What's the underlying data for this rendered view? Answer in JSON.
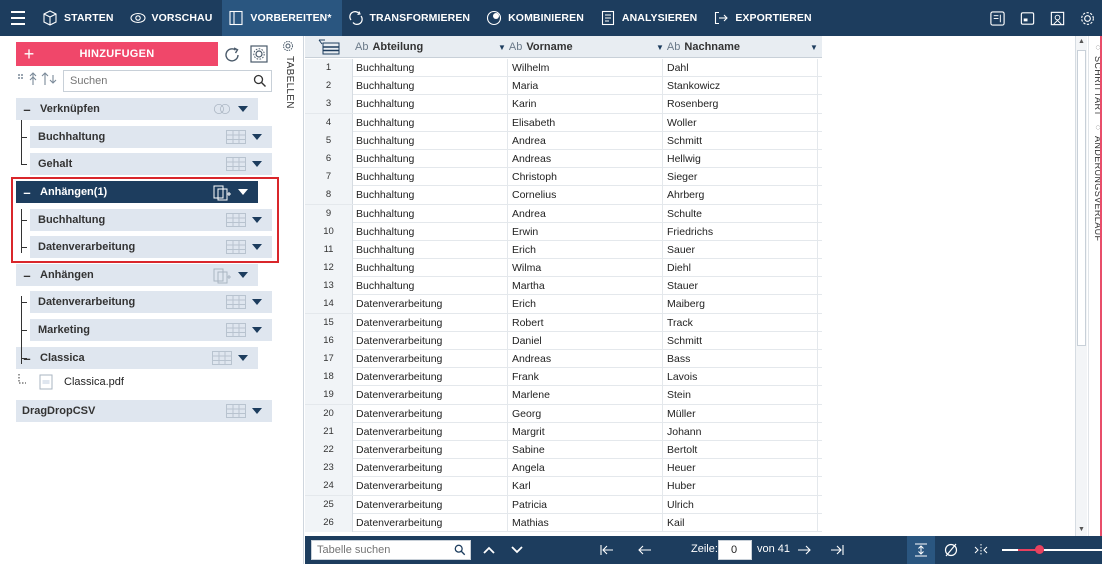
{
  "topbar": {
    "tabs": [
      {
        "label": "STARTEN",
        "icon": "cube-icon"
      },
      {
        "label": "VORSCHAU",
        "icon": "eye-icon"
      },
      {
        "label": "VORBEREITEN*",
        "icon": "table-columns-icon",
        "active": true
      },
      {
        "label": "TRANSFORMIEREN",
        "icon": "transform-icon"
      },
      {
        "label": "KOMBINIEREN",
        "icon": "combine-icon"
      },
      {
        "label": "ANALYSIEREN",
        "icon": "analyze-icon"
      },
      {
        "label": "EXPORTIEREN",
        "icon": "export-icon"
      }
    ],
    "right_icons": [
      "panel-icon",
      "window-icon",
      "book-icon",
      "gear-icon"
    ]
  },
  "colors": {
    "topbar": "#1d3d5e",
    "active_tab": "#2a5680",
    "add_button": "#f0476a",
    "highlight": "#d9262b",
    "group_bg": "#dfe6ef"
  },
  "left": {
    "add_label": "HINZUFUGEN",
    "tabellen_label": "TABELLEN",
    "search_placeholder": "Suchen",
    "tree": [
      {
        "kind": "group",
        "label": "Verknüpfen",
        "icon": "join-icon"
      },
      {
        "kind": "child",
        "label": "Buchhaltung"
      },
      {
        "kind": "child",
        "label": "Gehalt"
      },
      {
        "kind": "group-dark",
        "label": "Anhängen(1)",
        "icon": "append-icon"
      },
      {
        "kind": "child",
        "label": "Buchhaltung"
      },
      {
        "kind": "child",
        "label": "Datenverarbeitung"
      },
      {
        "kind": "group",
        "label": "Anhängen",
        "icon": "append-icon"
      },
      {
        "kind": "child",
        "label": "Datenverarbeitung"
      },
      {
        "kind": "child",
        "label": "Marketing"
      },
      {
        "kind": "group",
        "label": "Classica",
        "icon": "table-icon"
      },
      {
        "kind": "file",
        "label": "Classica.pdf"
      },
      {
        "kind": "table",
        "label": "DragDropCSV"
      }
    ]
  },
  "table": {
    "headers": [
      {
        "type": "Ab",
        "label": "Abteilung"
      },
      {
        "type": "Ab",
        "label": "Vorname"
      },
      {
        "type": "Ab",
        "label": "Nachname"
      }
    ],
    "rows": [
      [
        "1",
        "Buchhaltung",
        "Wilhelm",
        "Dahl"
      ],
      [
        "2",
        "Buchhaltung",
        "Maria",
        "Stankowicz"
      ],
      [
        "3",
        "Buchhaltung",
        "Karin",
        "Rosenberg"
      ],
      [
        "4",
        "Buchhaltung",
        "Elisabeth",
        "Woller"
      ],
      [
        "5",
        "Buchhaltung",
        "Andrea",
        "Schmitt"
      ],
      [
        "6",
        "Buchhaltung",
        "Andreas",
        "Hellwig"
      ],
      [
        "7",
        "Buchhaltung",
        "Christoph",
        "Sieger"
      ],
      [
        "8",
        "Buchhaltung",
        "Cornelius",
        "Ahrberg"
      ],
      [
        "9",
        "Buchhaltung",
        "Andrea",
        "Schulte"
      ],
      [
        "10",
        "Buchhaltung",
        "Erwin",
        "Friedrichs"
      ],
      [
        "11",
        "Buchhaltung",
        "Erich",
        "Sauer"
      ],
      [
        "12",
        "Buchhaltung",
        "Wilma",
        "Diehl"
      ],
      [
        "13",
        "Buchhaltung",
        "Martha",
        "Stauer"
      ],
      [
        "14",
        "Datenverarbeitung",
        "Erich",
        "Maiberg"
      ],
      [
        "15",
        "Datenverarbeitung",
        "Robert",
        "Track"
      ],
      [
        "16",
        "Datenverarbeitung",
        "Daniel",
        "Schmitt"
      ],
      [
        "17",
        "Datenverarbeitung",
        "Andreas",
        "Bass"
      ],
      [
        "18",
        "Datenverarbeitung",
        "Frank",
        "Lavois"
      ],
      [
        "19",
        "Datenverarbeitung",
        "Marlene",
        "Stein"
      ],
      [
        "20",
        "Datenverarbeitung",
        "Georg",
        "Müller"
      ],
      [
        "21",
        "Datenverarbeitung",
        "Margrit",
        "Johann"
      ],
      [
        "22",
        "Datenverarbeitung",
        "Sabine",
        "Bertolt"
      ],
      [
        "23",
        "Datenverarbeitung",
        "Angela",
        "Heuer"
      ],
      [
        "24",
        "Datenverarbeitung",
        "Karl",
        "Huber"
      ],
      [
        "25",
        "Datenverarbeitung",
        "Patricia",
        "Ulrich"
      ],
      [
        "26",
        "Datenverarbeitung",
        "Mathias",
        "Kail"
      ]
    ]
  },
  "sidetabs": {
    "tab1": "SCHRITTART",
    "tab2": "ÄNDERUNGSVERLAUF"
  },
  "bottom": {
    "search_placeholder": "Tabelle suchen",
    "zeile_label": "Zeile:",
    "zeile_value": "0",
    "von_label": "von 41",
    "zoom_level": 0.37
  }
}
